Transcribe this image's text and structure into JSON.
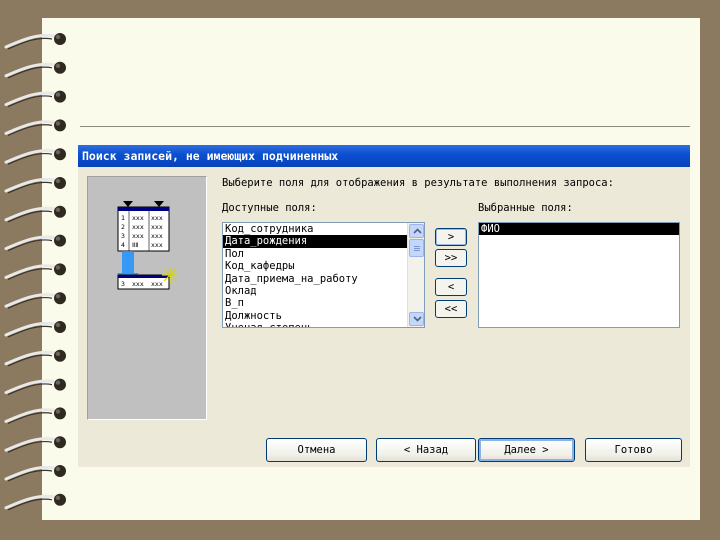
{
  "dialog": {
    "title": "Поиск записей, не имеющих подчиненных",
    "instruction": "Выберите поля для отображения в результате выполнения запроса:",
    "available_label": "Доступные поля:",
    "selected_label": "Выбранные поля:",
    "available_fields": [
      "Код_сотрудника",
      "Дата_рождения",
      "Пол",
      "Код_кафедры",
      "Дата_приема_на_работу",
      "Оклад",
      "В_п",
      "Должность",
      "Ученая степень"
    ],
    "selected_fields": [
      "ФИО"
    ],
    "move_buttons": {
      "add_one": ">",
      "add_all": ">>",
      "remove_one": "<",
      "remove_all": "<<"
    },
    "buttons": {
      "cancel": "Отмена",
      "back": "< Назад",
      "next": "Далее >",
      "finish": "Готово"
    },
    "illustration": {
      "rows": [
        "1",
        "2",
        "3",
        "4"
      ],
      "cells": [
        "ххх",
        "ххх",
        "ххх",
        "ххх",
        "ххх",
        "ххх",
        "ⅡⅡ",
        "ххх"
      ],
      "result_row": "3",
      "result_cells": [
        "ххх",
        "ххх"
      ]
    }
  },
  "colors": {
    "titlebar": "#0a4fd0",
    "dialog_bg": "#ece9d8",
    "paper": "#fbfbec",
    "background": "#8c7a60",
    "selection": "#000000"
  }
}
